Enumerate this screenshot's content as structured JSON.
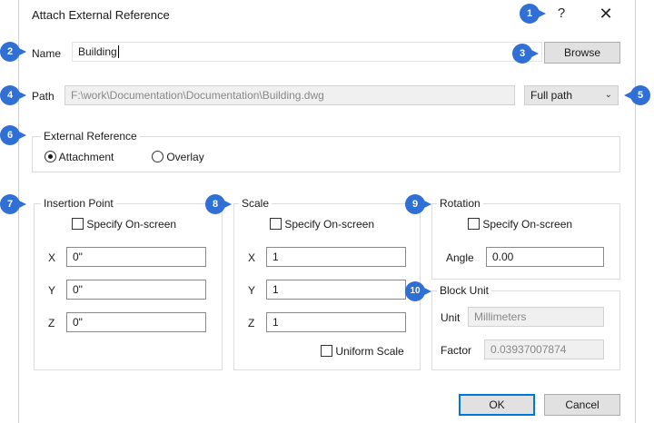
{
  "dialog": {
    "title": "Attach External Reference",
    "help_glyph": "?",
    "close_glyph": "✕"
  },
  "name": {
    "label": "Name",
    "value": "Building"
  },
  "browse_label": "Browse",
  "path": {
    "label": "Path",
    "value": "F:\\work\\Documentation\\Documentation\\Building.dwg",
    "type_value": "Full path"
  },
  "external_reference": {
    "title": "External Reference",
    "attachment": "Attachment",
    "overlay": "Overlay",
    "selected": "attachment"
  },
  "insertion_point": {
    "title": "Insertion Point",
    "specify": "Specify On-screen",
    "x_label": "X",
    "x": "0\"",
    "y_label": "Y",
    "y": "0\"",
    "z_label": "Z",
    "z": "0\""
  },
  "scale": {
    "title": "Scale",
    "specify": "Specify On-screen",
    "x_label": "X",
    "x": "1",
    "y_label": "Y",
    "y": "1",
    "z_label": "Z",
    "z": "1",
    "uniform": "Uniform Scale"
  },
  "rotation": {
    "title": "Rotation",
    "specify": "Specify On-screen",
    "angle_label": "Angle",
    "angle": "0.00"
  },
  "block_unit": {
    "title": "Block Unit",
    "unit_label": "Unit",
    "unit": "Millimeters",
    "factor_label": "Factor",
    "factor": "0.03937007874"
  },
  "footer": {
    "ok": "OK",
    "cancel": "Cancel"
  },
  "callouts": [
    "1",
    "2",
    "3",
    "4",
    "5",
    "6",
    "7",
    "8",
    "9",
    "10"
  ],
  "colors": {
    "callout": "#2f6fd6",
    "accent": "#0078d7"
  }
}
